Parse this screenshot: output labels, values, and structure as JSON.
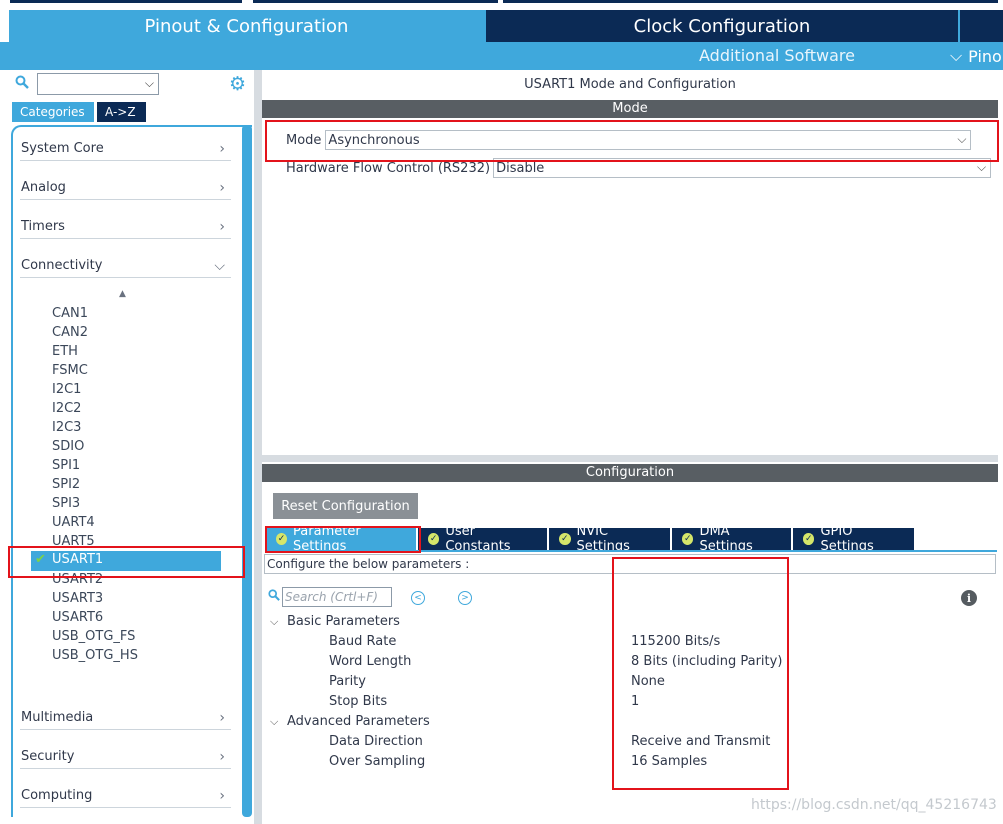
{
  "header": {
    "tabs": [
      {
        "label": "Pinout & Configuration",
        "active": true
      },
      {
        "label": "Clock Configuration",
        "active": false
      }
    ],
    "additional_software": "Additional Software",
    "pinout_label": "Pino"
  },
  "sidebar": {
    "search_value": "",
    "category_tabs": [
      "Categories",
      "A->Z"
    ],
    "categories_top": [
      {
        "label": "System Core",
        "expanded": false
      },
      {
        "label": "Analog",
        "expanded": false
      },
      {
        "label": "Timers",
        "expanded": false
      },
      {
        "label": "Connectivity",
        "expanded": true
      }
    ],
    "connectivity_items": [
      "CAN1",
      "CAN2",
      "ETH",
      "FSMC",
      "I2C1",
      "I2C2",
      "I2C3",
      "SDIO",
      "SPI1",
      "SPI2",
      "SPI3",
      "UART4",
      "UART5",
      "USART1",
      "USART2",
      "USART3",
      "USART6",
      "USB_OTG_FS",
      "USB_OTG_HS"
    ],
    "selected_item": "USART1",
    "categories_bottom": [
      {
        "label": "Multimedia",
        "expanded": false
      },
      {
        "label": "Security",
        "expanded": false
      },
      {
        "label": "Computing",
        "expanded": false
      }
    ]
  },
  "mode_panel": {
    "title": "USART1 Mode and Configuration",
    "section_label": "Mode",
    "mode_label": "Mode",
    "mode_value": "Asynchronous",
    "flow_label": "Hardware Flow Control (RS232)",
    "flow_value": "Disable"
  },
  "config_panel": {
    "section_label": "Configuration",
    "reset_button": "Reset Configuration",
    "tabs": [
      "Parameter Settings",
      "User Constants",
      "NVIC Settings",
      "DMA Settings",
      "GPIO Settings"
    ],
    "hint": "Configure the below parameters :",
    "search_placeholder": "Search (Crtl+F)",
    "groups": [
      {
        "name": "Basic Parameters",
        "params": [
          {
            "name": "Baud Rate",
            "value": "115200 Bits/s"
          },
          {
            "name": "Word Length",
            "value": "8 Bits (including Parity)"
          },
          {
            "name": "Parity",
            "value": "None"
          },
          {
            "name": "Stop Bits",
            "value": "1"
          }
        ]
      },
      {
        "name": "Advanced Parameters",
        "params": [
          {
            "name": "Data Direction",
            "value": "Receive and Transmit"
          },
          {
            "name": "Over Sampling",
            "value": "16 Samples"
          }
        ]
      }
    ]
  },
  "watermark": "https://blog.csdn.net/qq_45216743",
  "colors": {
    "accent": "#3fa8dc",
    "navy": "#0b2a55",
    "section_gray": "#585e63",
    "annotation_red": "#e3131b"
  }
}
